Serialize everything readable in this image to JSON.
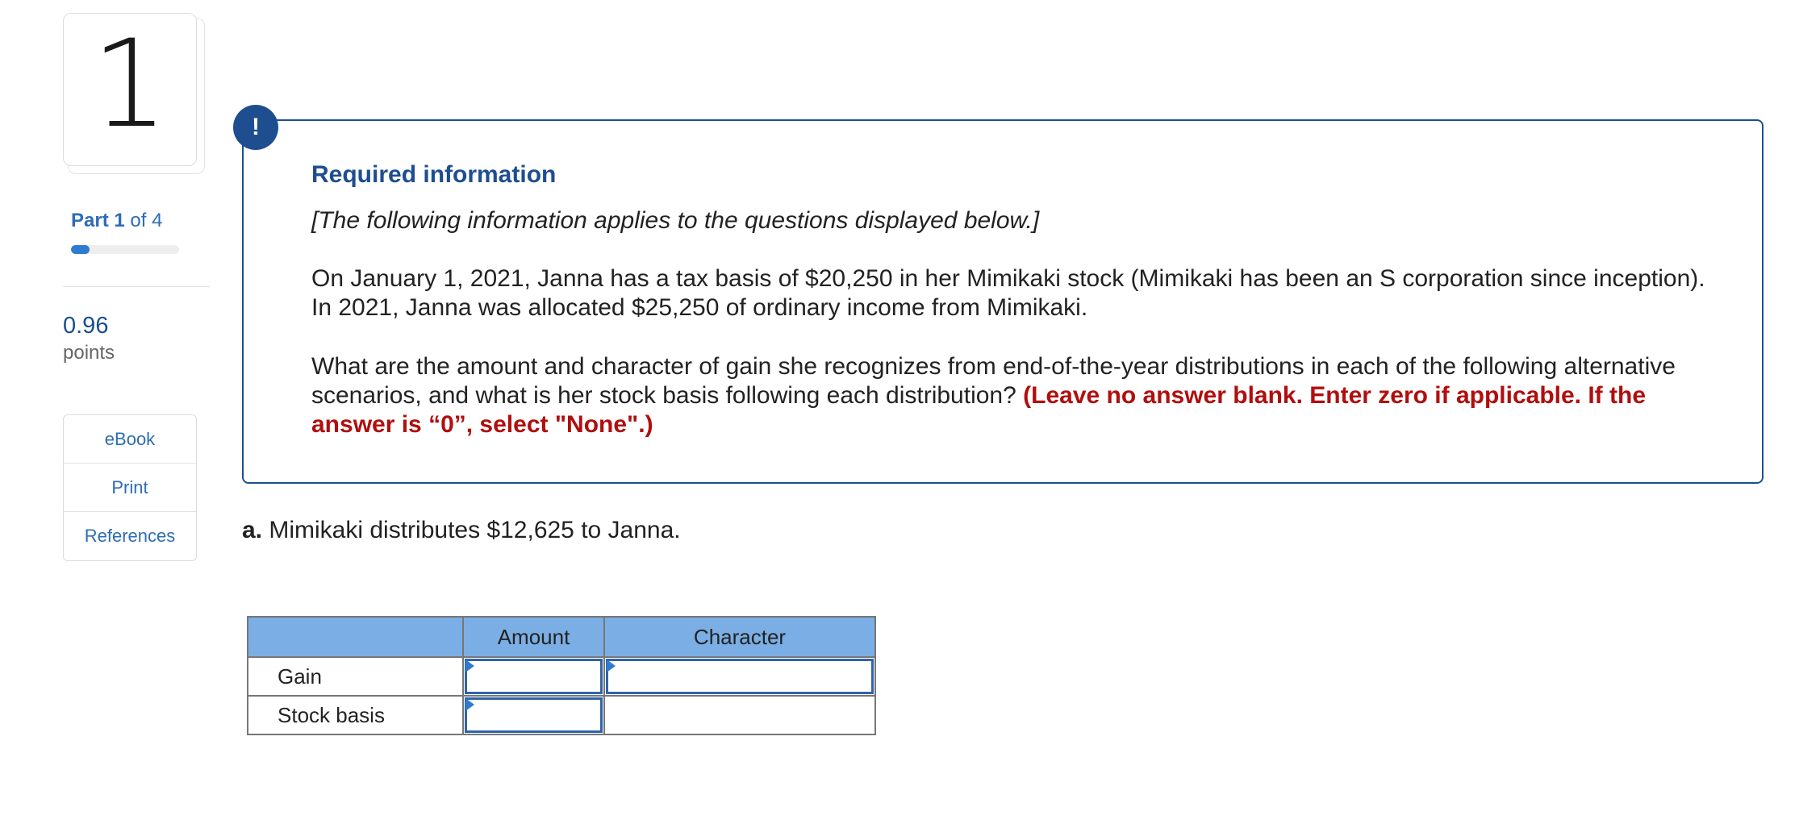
{
  "question": {
    "number": "1",
    "part_label": "Part",
    "part_current": "1",
    "part_of": "of 4",
    "progress_fraction": 0.17,
    "points_value": "0.96",
    "points_label": "points"
  },
  "sidebar": {
    "buttons": [
      {
        "label": "eBook"
      },
      {
        "label": "Print"
      },
      {
        "label": "References"
      }
    ]
  },
  "info": {
    "title": "Required information",
    "note": "[The following information applies to the questions displayed below.]",
    "para1": "On January 1, 2021, Janna has a tax basis of $20,250 in her Mimikaki stock (Mimikaki has been an S corporation since inception). In 2021, Janna was allocated $25,250 of ordinary income from Mimikaki.",
    "para2_main": "What are the amount and character of gain she recognizes from end-of-the-year distributions in each of the following alternative scenarios, and what is her stock basis following each distribution? ",
    "para2_instruction": "(Leave no answer blank. Enter zero if applicable. If the answer is “0”, select \"None\".)"
  },
  "part_a": {
    "label": "a.",
    "text": " Mimikaki distributes $12,625 to Janna."
  },
  "table": {
    "headers": [
      "",
      "Amount",
      "Character"
    ],
    "rows": [
      {
        "label": "Gain",
        "amount": "",
        "character": ""
      },
      {
        "label": "Stock basis",
        "amount": ""
      }
    ]
  },
  "colors": {
    "accent": "#1e4e8f",
    "link": "#2d6db5",
    "header_fill": "#7aaee5",
    "instruction_red": "#b10e0e"
  }
}
